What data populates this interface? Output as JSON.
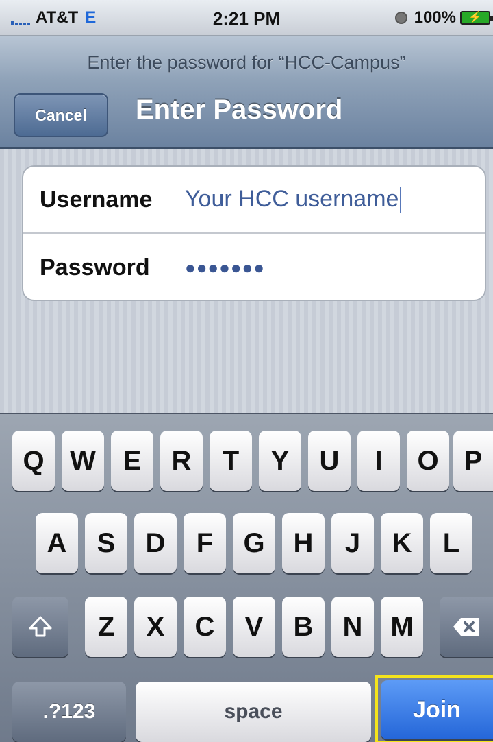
{
  "status_bar": {
    "carrier": "AT&T",
    "network": "E",
    "time": "2:21 PM",
    "battery": "100%"
  },
  "header": {
    "prompt": "Enter the password for “HCC-Campus”",
    "cancel_label": "Cancel",
    "title": "Enter Password"
  },
  "form": {
    "username_label": "Username",
    "username_value": "Your HCC username",
    "password_label": "Password",
    "password_mask": "●●●●●●●"
  },
  "keyboard": {
    "row1": [
      "Q",
      "W",
      "E",
      "R",
      "T",
      "Y",
      "U",
      "I",
      "O",
      "P"
    ],
    "row2": [
      "A",
      "S",
      "D",
      "F",
      "G",
      "H",
      "J",
      "K",
      "L"
    ],
    "row3": [
      "Z",
      "X",
      "C",
      "V",
      "B",
      "N",
      "M"
    ],
    "numbers_label": ".?123",
    "space_label": "space",
    "join_label": "Join",
    "shift_icon": "shift-icon",
    "delete_icon": "backspace-icon"
  },
  "colors": {
    "join_highlight": "#f5e41c",
    "join_key": "#2466d8",
    "nav_bar": "#6b82a0"
  }
}
